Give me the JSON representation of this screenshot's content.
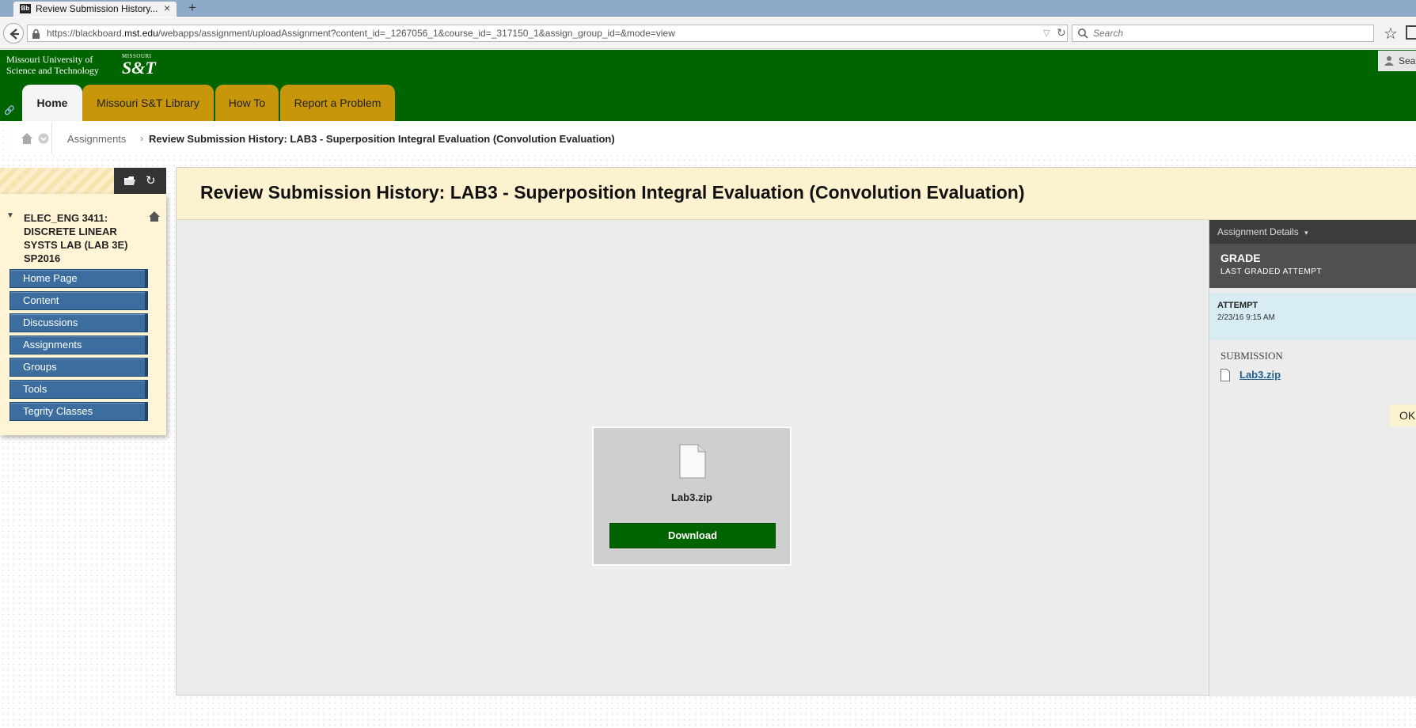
{
  "browser": {
    "tab_title": "Review Submission History...",
    "tab_favicon_text": "Bb",
    "url_prefix": "https://blackboard.",
    "url_domain": "mst.edu",
    "url_path": "/webapps/assignment/uploadAssignment?content_id=_1267056_1&course_id=_317150_1&assign_group_id=&mode=view",
    "search_placeholder": "Search"
  },
  "header": {
    "logo_line1": "Missouri University of",
    "logo_line2": "Science and Technology",
    "logo_mark_top": "MISSOURI",
    "logo_mark": "S&T",
    "user_label": "Sea",
    "tabs": [
      {
        "label": "Home"
      },
      {
        "label": "Missouri S&T Library"
      },
      {
        "label": "How To"
      },
      {
        "label": "Report a Problem"
      }
    ]
  },
  "breadcrumb": {
    "parent": "Assignments",
    "separator": "›",
    "current": "Review Submission History: LAB3 - Superposition Integral Evaluation (Convolution Evaluation)"
  },
  "course_menu": {
    "title_lines": [
      "ELEC_ENG 3411:",
      "DISCRETE LINEAR",
      "SYSTS LAB (LAB 3E)",
      "SP2016"
    ],
    "items": [
      {
        "label": "Home Page"
      },
      {
        "label": "Content"
      },
      {
        "label": "Discussions"
      },
      {
        "label": "Assignments"
      },
      {
        "label": "Groups"
      },
      {
        "label": "Tools"
      },
      {
        "label": "Tegrity Classes"
      }
    ]
  },
  "main": {
    "page_title": "Review Submission History: LAB3 - Superposition Integral Evaluation (Convolution Evaluation)",
    "viewer": {
      "file_name": "Lab3.zip",
      "download_label": "Download"
    }
  },
  "right_panel": {
    "details_label": "Assignment Details",
    "grade_title": "GRADE",
    "grade_sub": "LAST GRADED ATTEMPT",
    "attempt_title": "ATTEMPT",
    "attempt_date": "2/23/16 9:15 AM",
    "submission_label": "SUBMISSION",
    "submission_file": "Lab3.zip",
    "ok_label": "OK"
  },
  "colors": {
    "brand_green": "#006400",
    "tab_gold": "#c8960a",
    "menu_blue": "#3b6e9f",
    "header_cream": "#fdf2cf"
  }
}
